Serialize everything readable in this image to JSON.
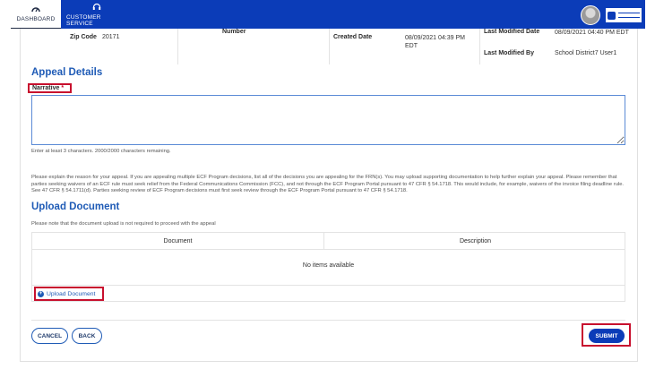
{
  "nav": {
    "dashboard_label": "DASHBOARD",
    "customer_service_label": "CUSTOMER SERVICE"
  },
  "details": {
    "zip_label": "Zip Code",
    "zip_value": "20171",
    "number_label": "Number",
    "created_label": "Created Date",
    "created_value": "08/09/2021 04:39 PM EDT",
    "last_modified_date_label": "Last Modified Date",
    "last_modified_date_value": "08/09/2021 04:40 PM EDT",
    "last_modified_by_label": "Last Modified By",
    "last_modified_by_value": "School District7 User1"
  },
  "appeal": {
    "title": "Appeal Details",
    "narrative_label": "Narrative",
    "required_mark": "*",
    "narrative_value": "",
    "char_help": "Enter at least 3 characters. 2000/2000 characters remaining.",
    "explanation": "Please explain the reason for your appeal. If you are appealing multiple ECF Program decisions, list all of the decisions you are appealing for the FRN(s). You may upload supporting documentation to help further explain your appeal. Please remember that parties seeking waivers of an ECF rule must seek relief from the Federal Communications Commission (FCC), and not through the ECF Program Portal pursuant to 47 CFR § 54.1718. This would include, for example, waivers of the invoice filing deadline rule. See 47 CFR § 54.1711(d). Parties seeking review of ECF Program decisions must first seek review through the ECF Program Portal pursuant to 47 CFR § 54.1718."
  },
  "upload": {
    "title": "Upload Document",
    "note": "Please note that the document upload is not required to proceed with the appeal",
    "columns": [
      "Document",
      "Description"
    ],
    "empty_message": "No items available",
    "upload_link": "Upload Document"
  },
  "actions": {
    "cancel": "CANCEL",
    "back": "BACK",
    "submit": "SUBMIT"
  },
  "icons": {
    "dashboard": "speedometer-icon",
    "customer_service": "headset-icon",
    "upload": "plus-circle-icon"
  },
  "colors": {
    "brand_blue": "#0b3cb8",
    "heading_blue": "#1f5bb6",
    "highlight_red": "#c8102e"
  }
}
